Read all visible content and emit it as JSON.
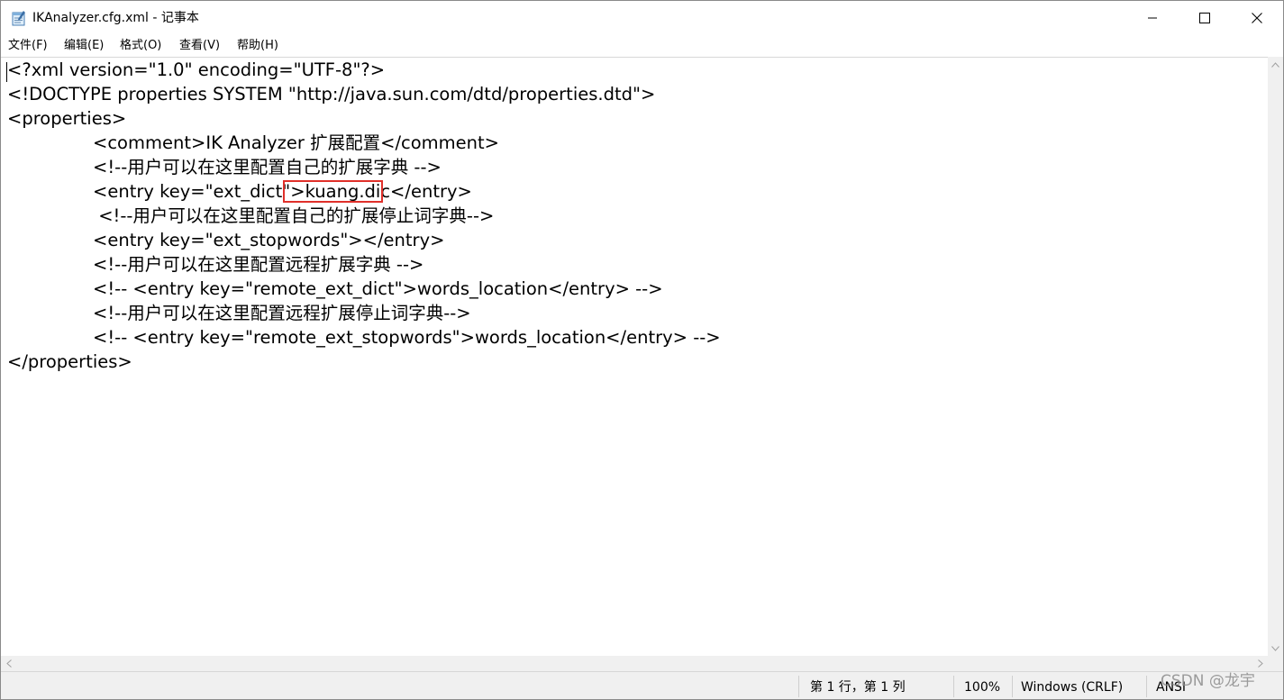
{
  "window": {
    "title": "IKAnalyzer.cfg.xml - 记事本",
    "icon": "notepad-icon",
    "controls": [
      "minimize-icon",
      "maximize-icon",
      "close-icon"
    ]
  },
  "menu": [
    {
      "label": "文件(F)"
    },
    {
      "label": "编辑(E)"
    },
    {
      "label": "格式(O)"
    },
    {
      "label": "查看(V)"
    },
    {
      "label": "帮助(H)"
    }
  ],
  "editor": {
    "lines": [
      "<?xml version=\"1.0\" encoding=\"UTF-8\"?>",
      "<!DOCTYPE properties SYSTEM \"http://java.sun.com/dtd/properties.dtd\">",
      "<properties>",
      "\t<comment>IK Analyzer 扩展配置</comment>",
      "\t<!--用户可以在这里配置自己的扩展字典 -->",
      "\t<entry key=\"ext_dict\">kuang.dic</entry>",
      "\t <!--用户可以在这里配置自己的扩展停止词字典-->",
      "\t<entry key=\"ext_stopwords\"></entry>",
      "\t<!--用户可以在这里配置远程扩展字典 -->",
      "\t<!-- <entry key=\"remote_ext_dict\">words_location</entry> -->",
      "\t<!--用户可以在这里配置远程扩展停止词字典-->",
      "\t<!-- <entry key=\"remote_ext_stopwords\">words_location</entry> -->",
      "</properties>"
    ],
    "highlighted_text": "kuang.dic",
    "highlight_color": "#e0302a"
  },
  "status": {
    "position": "第 1 行，第 1 列",
    "zoom": "100%",
    "line_ending": "Windows (CRLF)",
    "encoding": "ANSI"
  },
  "watermark": "CSDN @龙宇"
}
